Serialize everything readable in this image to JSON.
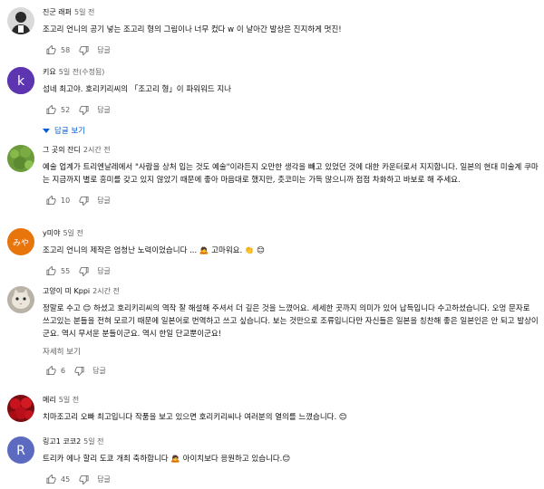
{
  "comments": [
    {
      "author": "진군 래퍼",
      "time": "5일 전",
      "text": "조고리 언니의 공기 넣는 조고리 형의 그림이나 너무 컸다 w 이 날아간 발상은 진지하게 멋진!",
      "likes": "58",
      "reply_label": "답글",
      "avatar_icon": "person-silhouette-avatar"
    },
    {
      "author": "키요",
      "time": "5일 전(수정됨)",
      "text": "섬네 최고야. 호리키리씨의 「조고리 형」이 파워워드 지나",
      "likes": "52",
      "reply_label": "답글",
      "avatar_letter": "k",
      "avatar_color": "#5e35b1",
      "replies_label": "답글 보기"
    },
    {
      "author": "그 곳의 잔디",
      "time": "2시간 전",
      "text": "예술 업계가 트리엔날레에서 \"사람을 상처 입는 것도 예술\"이라든지 오만한 생각을 빼고 있었던 것에 대한 카운터로서 지지합니다. 일본의 현대 미술계 쿠마는 지금까지 별로 흥미를 갖고 있지 않았기 때문에 좋아 마음대로 했지만, 츳코미는 가득 많으니까 점점 차화하고 바보로 해 주세요.",
      "likes": "10",
      "reply_label": "답글",
      "avatar_icon": "grass-avatar"
    },
    {
      "author": "y미야",
      "time": "5일 전",
      "text": "조고리 언니의 제작은 엄청난 노력이었습니다 ... 🙇 고마워요. 👏 😊",
      "likes": "55",
      "reply_label": "답글",
      "avatar_letter": "みや",
      "avatar_color": "#e8740c"
    },
    {
      "author": "고양이 미 Kppi",
      "time": "2시간 전",
      "text": "정말로 수고 😊 하셨고 호리키리씨의 역작 잘 해설해 주셔서 더 깊은 것을 느꼈어요. 세세한 곳까지 의미가 있어 납득입니다 수고하셨습니다. 오멍 문자로 쓰고있는 분들을 전혀 모르기 때문에 일본어로 번역하고 쓰고 싶습니다. 보는 것만으로 조류입니다만 자신들은 일본을 칭찬해 좋은 일본인은 안 되고 발상이군요. 역시 무서운 분들이군요. 역시 한일 단교뿐이군요!",
      "more_label": "자세히 보기",
      "likes": "6",
      "reply_label": "답글",
      "avatar_icon": "cat-avatar"
    },
    {
      "author": "메리",
      "time": "5일 전",
      "text": "치마조고리 오빠 최고입니다 작품을 보고 있으면 호리키리씨나 여러분의 열의를 느꼈습니다. 😊",
      "likes": "",
      "reply_label": "답글",
      "avatar_icon": "red-roses-avatar"
    },
    {
      "author": "링고1 코코2",
      "time": "5일 전",
      "text": "트리카 에나 할리 도쿄 개최 축하합니다 🙇 아이치보다 응원하고 있습니다.😊",
      "likes": "45",
      "reply_label": "답글",
      "avatar_letter": "R",
      "avatar_color": "#5c6bc0"
    }
  ]
}
